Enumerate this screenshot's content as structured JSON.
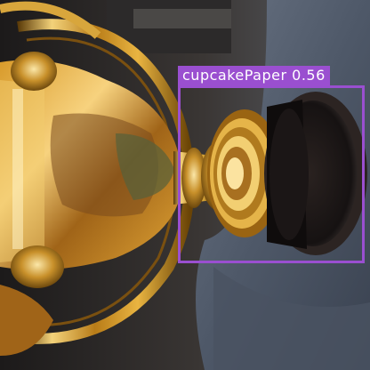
{
  "detection": {
    "label": "cupcakePaper",
    "score": "0.56",
    "box_color": "#9a4fd0"
  }
}
